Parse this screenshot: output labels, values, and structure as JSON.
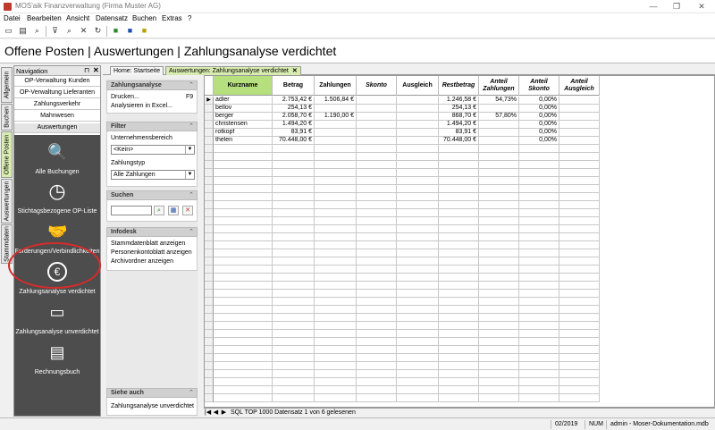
{
  "window": {
    "title": "MOS'aik Finanzverwaltung (Firma Muster AG)",
    "min": "—",
    "max": "❐",
    "close": "✕"
  },
  "menu": [
    "Datei",
    "Bearbeiten",
    "Ansicht",
    "Datensatz",
    "Buchen",
    "Extras",
    "?"
  ],
  "page_title": "Offene Posten | Auswertungen | Zahlungsanalyse verdichtet",
  "vtabs": [
    "Allgemein",
    "Buchen",
    "Offene Posten",
    "Auswertungen",
    "Stammdaten"
  ],
  "nav": {
    "title": "Navigation",
    "pin": "⊓",
    "close": "✕",
    "links": [
      "OP-Verwaltung Kunden",
      "OP-Verwaltung Lieferanten",
      "Zahlungsverkehr",
      "Mahnwesen",
      "Auswertungen"
    ],
    "items": [
      {
        "label": "Alle Buchungen",
        "icon": "search-icon",
        "glyph": "🔍"
      },
      {
        "label": "Stichtagsbezogene OP-Liste",
        "icon": "clock-icon",
        "glyph": "◷"
      },
      {
        "label": "Forderungen/Verbindlichkeiten",
        "icon": "handshake-icon",
        "glyph": "🤝"
      },
      {
        "label": "Zahlungsanalyse verdichtet",
        "icon": "euro-icon",
        "glyph": "€"
      },
      {
        "label": "Zahlungsanalyse unverdichtet",
        "icon": "wallet-icon",
        "glyph": "▭"
      },
      {
        "label": "Rechnungsbuch",
        "icon": "document-icon",
        "glyph": "▤"
      }
    ]
  },
  "doc_tabs": [
    {
      "label": "Home: Startseite"
    },
    {
      "label": "Auswertungen: Zahlungsanalyse verdichtet",
      "close": "✕"
    }
  ],
  "task_panel": {
    "analyse": {
      "title": "Zahlungsanalyse",
      "items": [
        {
          "label": "Drucken...",
          "shortcut": "F9"
        },
        {
          "label": "Analysieren in Excel..."
        }
      ]
    },
    "filter": {
      "title": "Filter",
      "label1": "Unternehmensbereich",
      "value1": "<Kein>",
      "label2": "Zahlungstyp",
      "value2": "Alle Zahlungen"
    },
    "suchen": {
      "title": "Suchen"
    },
    "infodesk": {
      "title": "Infodesk",
      "items": [
        "Stammdatenblatt anzeigen",
        "Personenkontoblatt anzeigen",
        "Archivordner anzeigen"
      ]
    },
    "siehe": {
      "title": "Siehe auch",
      "items": [
        "Zahlungsanalyse unverdichtet"
      ]
    }
  },
  "grid": {
    "columns": [
      "Kurzname",
      "Betrag",
      "Zahlungen",
      "Skonto",
      "Ausgleich",
      "Restbetrag",
      "Anteil Zahlungen",
      "Anteil Skonto",
      "Anteil Ausgleich"
    ],
    "rows": [
      [
        "adler",
        "2.753,42 €",
        "1.506,84 €",
        "",
        "",
        "1.246,58 €",
        "54,73%",
        "0,00%",
        ""
      ],
      [
        "bellov",
        "254,13 €",
        "",
        "",
        "",
        "254,13 €",
        "",
        "0,00%",
        ""
      ],
      [
        "berger",
        "2.058,70 €",
        "1.190,00 €",
        "",
        "",
        "868,70 €",
        "57,80%",
        "0,00%",
        ""
      ],
      [
        "christensen",
        "1.494,20 €",
        "",
        "",
        "",
        "1.494,20 €",
        "",
        "0,00%",
        ""
      ],
      [
        "rotkopf",
        "83,91 €",
        "",
        "",
        "",
        "83,91 €",
        "",
        "0,00%",
        ""
      ],
      [
        "thelen",
        "70.448,00 €",
        "",
        "",
        "",
        "70.448,00 €",
        "",
        "0,00%",
        ""
      ]
    ]
  },
  "record_nav": {
    "text": "SQL TOP 1000 Datensatz 1 von 6 gelesenen",
    "first": "|◀",
    "prev": "◀",
    "next": "▶",
    "last": "▶|"
  },
  "status": {
    "period": "02/2019",
    "num": "NUM",
    "db": "admin - Moser-Dokumentation.mdb"
  }
}
